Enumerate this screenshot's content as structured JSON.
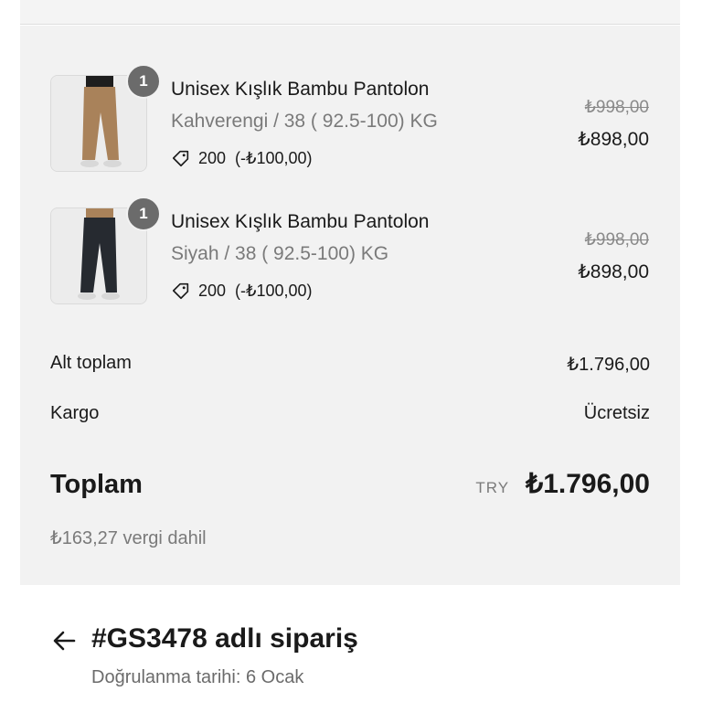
{
  "items": [
    {
      "quantity": "1",
      "name": "Unisex Kışlık Bambu Pantolon",
      "variant": "Kahverengi / 38 ( 92.5-100) KG",
      "discount_code": "200",
      "discount_amount": "(-₺100,00)",
      "price_original": "₺998,00",
      "price_final": "₺898,00",
      "image_icon": "brown-pants-photo",
      "pants_color": "#a9825a"
    },
    {
      "quantity": "1",
      "name": "Unisex Kışlık Bambu Pantolon",
      "variant": "Siyah / 38 ( 92.5-100) KG",
      "discount_code": "200",
      "discount_amount": "(-₺100,00)",
      "price_original": "₺998,00",
      "price_final": "₺898,00",
      "image_icon": "black-pants-photo",
      "pants_color": "#262a30"
    }
  ],
  "summary": {
    "subtotal_label": "Alt toplam",
    "subtotal_value": "₺1.796,00",
    "shipping_label": "Kargo",
    "shipping_value": "Ücretsiz",
    "total_label": "Toplam",
    "currency": "TRY",
    "total_value": "₺1.796,00",
    "tax_note": "₺163,27 vergi dahil"
  },
  "order": {
    "title": "#GS3478 adlı sipariş",
    "confirmed": "Doğrulanma tarihi: 6 Ocak"
  },
  "icons": {
    "tag": "tag-icon",
    "back": "arrow-left-icon"
  },
  "colors": {
    "summary_bg": "#f2f2f2",
    "badge_bg": "#6b6b6b",
    "muted_text": "#7a7a7a"
  }
}
